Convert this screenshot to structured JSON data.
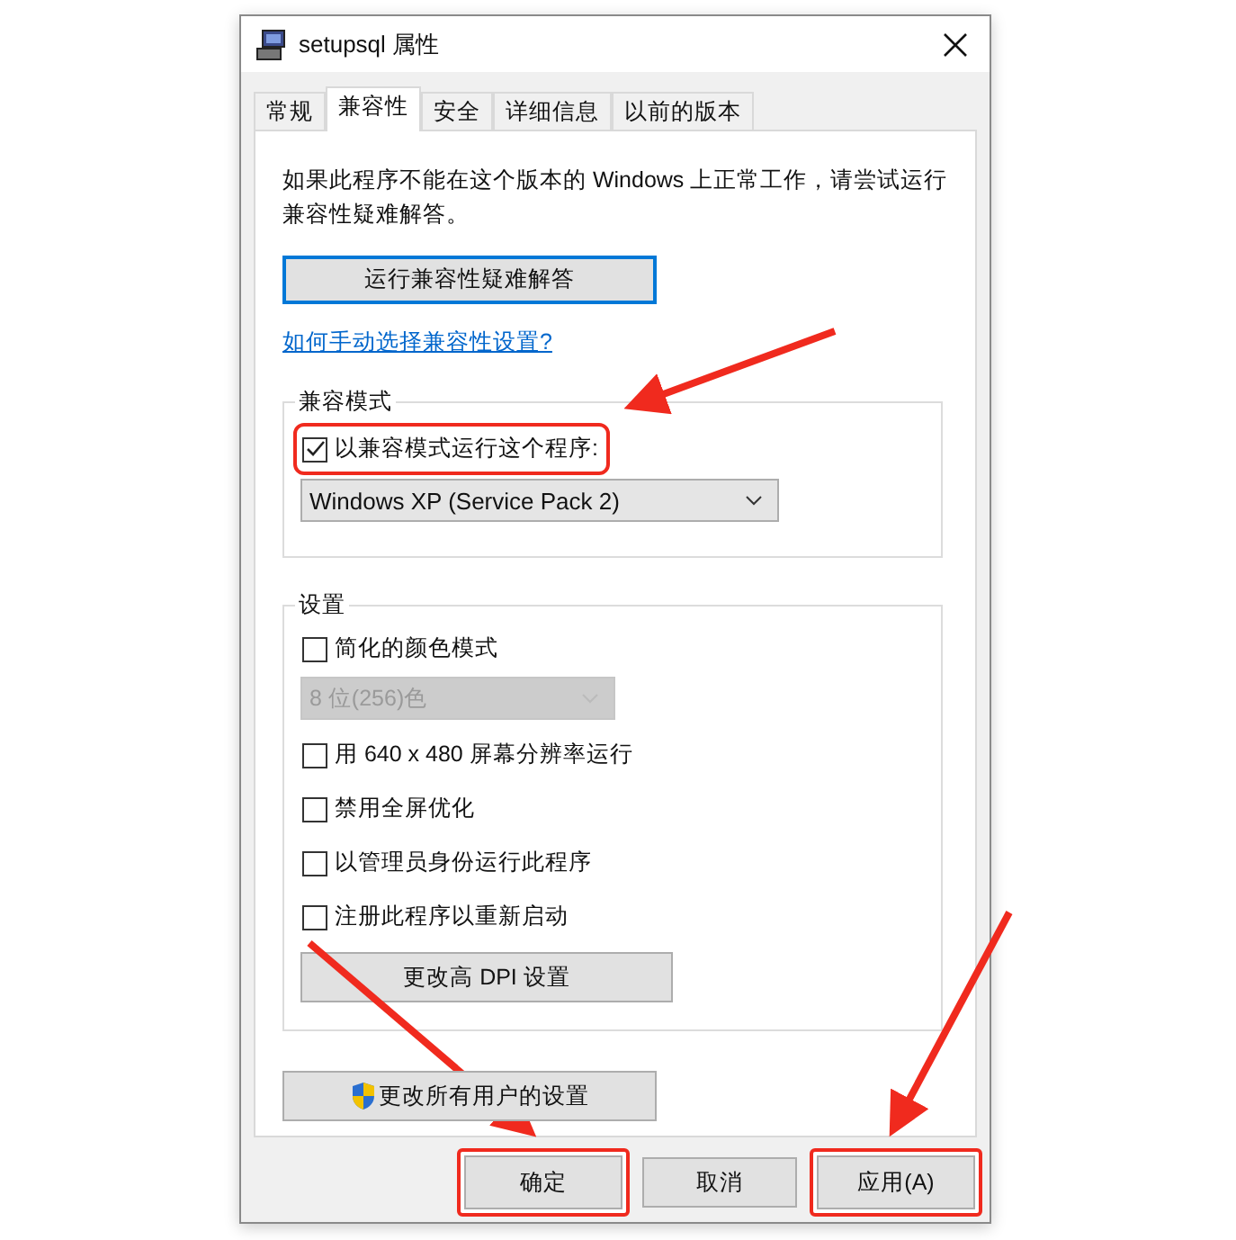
{
  "window": {
    "title": "setupsql 属性"
  },
  "tabs": [
    {
      "label": "常规",
      "selected": false
    },
    {
      "label": "兼容性",
      "selected": true
    },
    {
      "label": "安全",
      "selected": false
    },
    {
      "label": "详细信息",
      "selected": false
    },
    {
      "label": "以前的版本",
      "selected": false
    }
  ],
  "description": "如果此程序不能在这个版本的 Windows 上正常工作，请尝试运行兼容性疑难解答。",
  "troubleshoot_button": "运行兼容性疑难解答",
  "help_link": "如何手动选择兼容性设置?",
  "compat_group": {
    "title": "兼容模式",
    "checkbox": {
      "label": "以兼容模式运行这个程序:",
      "checked": true,
      "highlighted": true
    },
    "os_select": {
      "value": "Windows XP (Service Pack 2)",
      "disabled": false
    }
  },
  "settings_group": {
    "title": "设置",
    "items": [
      {
        "kind": "checkbox",
        "label": "简化的颜色模式",
        "checked": false
      },
      {
        "kind": "select",
        "value": "8 位(256)色",
        "disabled": true
      },
      {
        "kind": "checkbox",
        "label": "用 640 x 480 屏幕分辨率运行",
        "checked": false
      },
      {
        "kind": "checkbox",
        "label": "禁用全屏优化",
        "checked": false
      },
      {
        "kind": "checkbox",
        "label": "以管理员身份运行此程序",
        "checked": false
      },
      {
        "kind": "checkbox",
        "label": "注册此程序以重新启动",
        "checked": false
      },
      {
        "kind": "button",
        "label": "更改高 DPI 设置"
      }
    ]
  },
  "all_users_button": "更改所有用户的设置",
  "buttons": [
    {
      "label": "确定",
      "highlighted": true
    },
    {
      "label": "取消",
      "highlighted": false
    },
    {
      "label": "应用(A)",
      "highlighted": true
    }
  ]
}
